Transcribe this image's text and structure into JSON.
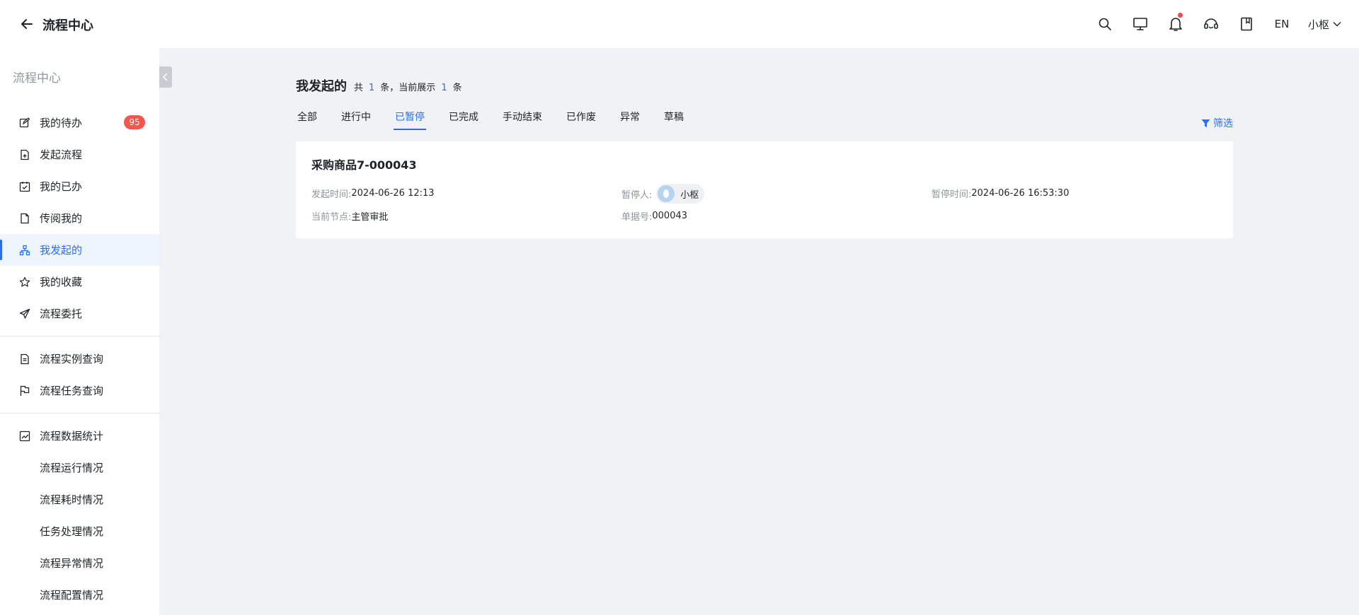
{
  "header": {
    "app_title": "流程中心",
    "lang": "EN",
    "user_name": "小枢",
    "icons": [
      "back-arrow-icon",
      "search-icon",
      "monitor-icon",
      "bell-icon",
      "headset-icon",
      "bookmark-icon",
      "chevron-down-icon"
    ]
  },
  "sidebar": {
    "title": "流程中心",
    "items": [
      {
        "label": "我的待办",
        "icon": "edit-icon",
        "badge": "95"
      },
      {
        "label": "发起流程",
        "icon": "document-add-icon"
      },
      {
        "label": "我的已办",
        "icon": "calendar-check-icon"
      },
      {
        "label": "传阅我的",
        "icon": "document-icon"
      },
      {
        "label": "我发起的",
        "icon": "flow-icon",
        "active": true
      },
      {
        "label": "我的收藏",
        "icon": "star-icon"
      },
      {
        "label": "流程委托",
        "icon": "send-icon"
      },
      {
        "label": "流程实例查询",
        "icon": "file-search-icon"
      },
      {
        "label": "流程任务查询",
        "icon": "flag-icon"
      },
      {
        "label": "流程数据统计",
        "icon": "chart-icon"
      },
      {
        "label": "流程运行情况"
      },
      {
        "label": "流程耗时情况"
      },
      {
        "label": "任务处理情况"
      },
      {
        "label": "流程异常情况"
      },
      {
        "label": "流程配置情况"
      }
    ]
  },
  "main": {
    "title": "我发起的",
    "count_prefix": "共",
    "total": "1",
    "count_mid": "条，当前展示",
    "shown": "1",
    "count_suffix": "条",
    "tabs": [
      "全部",
      "进行中",
      "已暂停",
      "已完成",
      "手动结束",
      "已作废",
      "异常",
      "草稿"
    ],
    "active_tab": "已暂停",
    "filter_label": "筛选"
  },
  "card": {
    "title": "采购商品7-000043",
    "start_time_label": "发起时间:",
    "start_time": "2024-06-26 12:13",
    "pauser_label": "暂停人:",
    "pauser": "小枢",
    "pause_time_label": "暂停时间:",
    "pause_time": "2024-06-26 16:53:30",
    "node_label": "当前节点:",
    "node": "主管审批",
    "doc_no_label": "单据号:",
    "doc_no": "000043"
  },
  "colors": {
    "accent": "#2b6ef5",
    "badge": "#f4564e",
    "background": "#f0f2f5"
  }
}
